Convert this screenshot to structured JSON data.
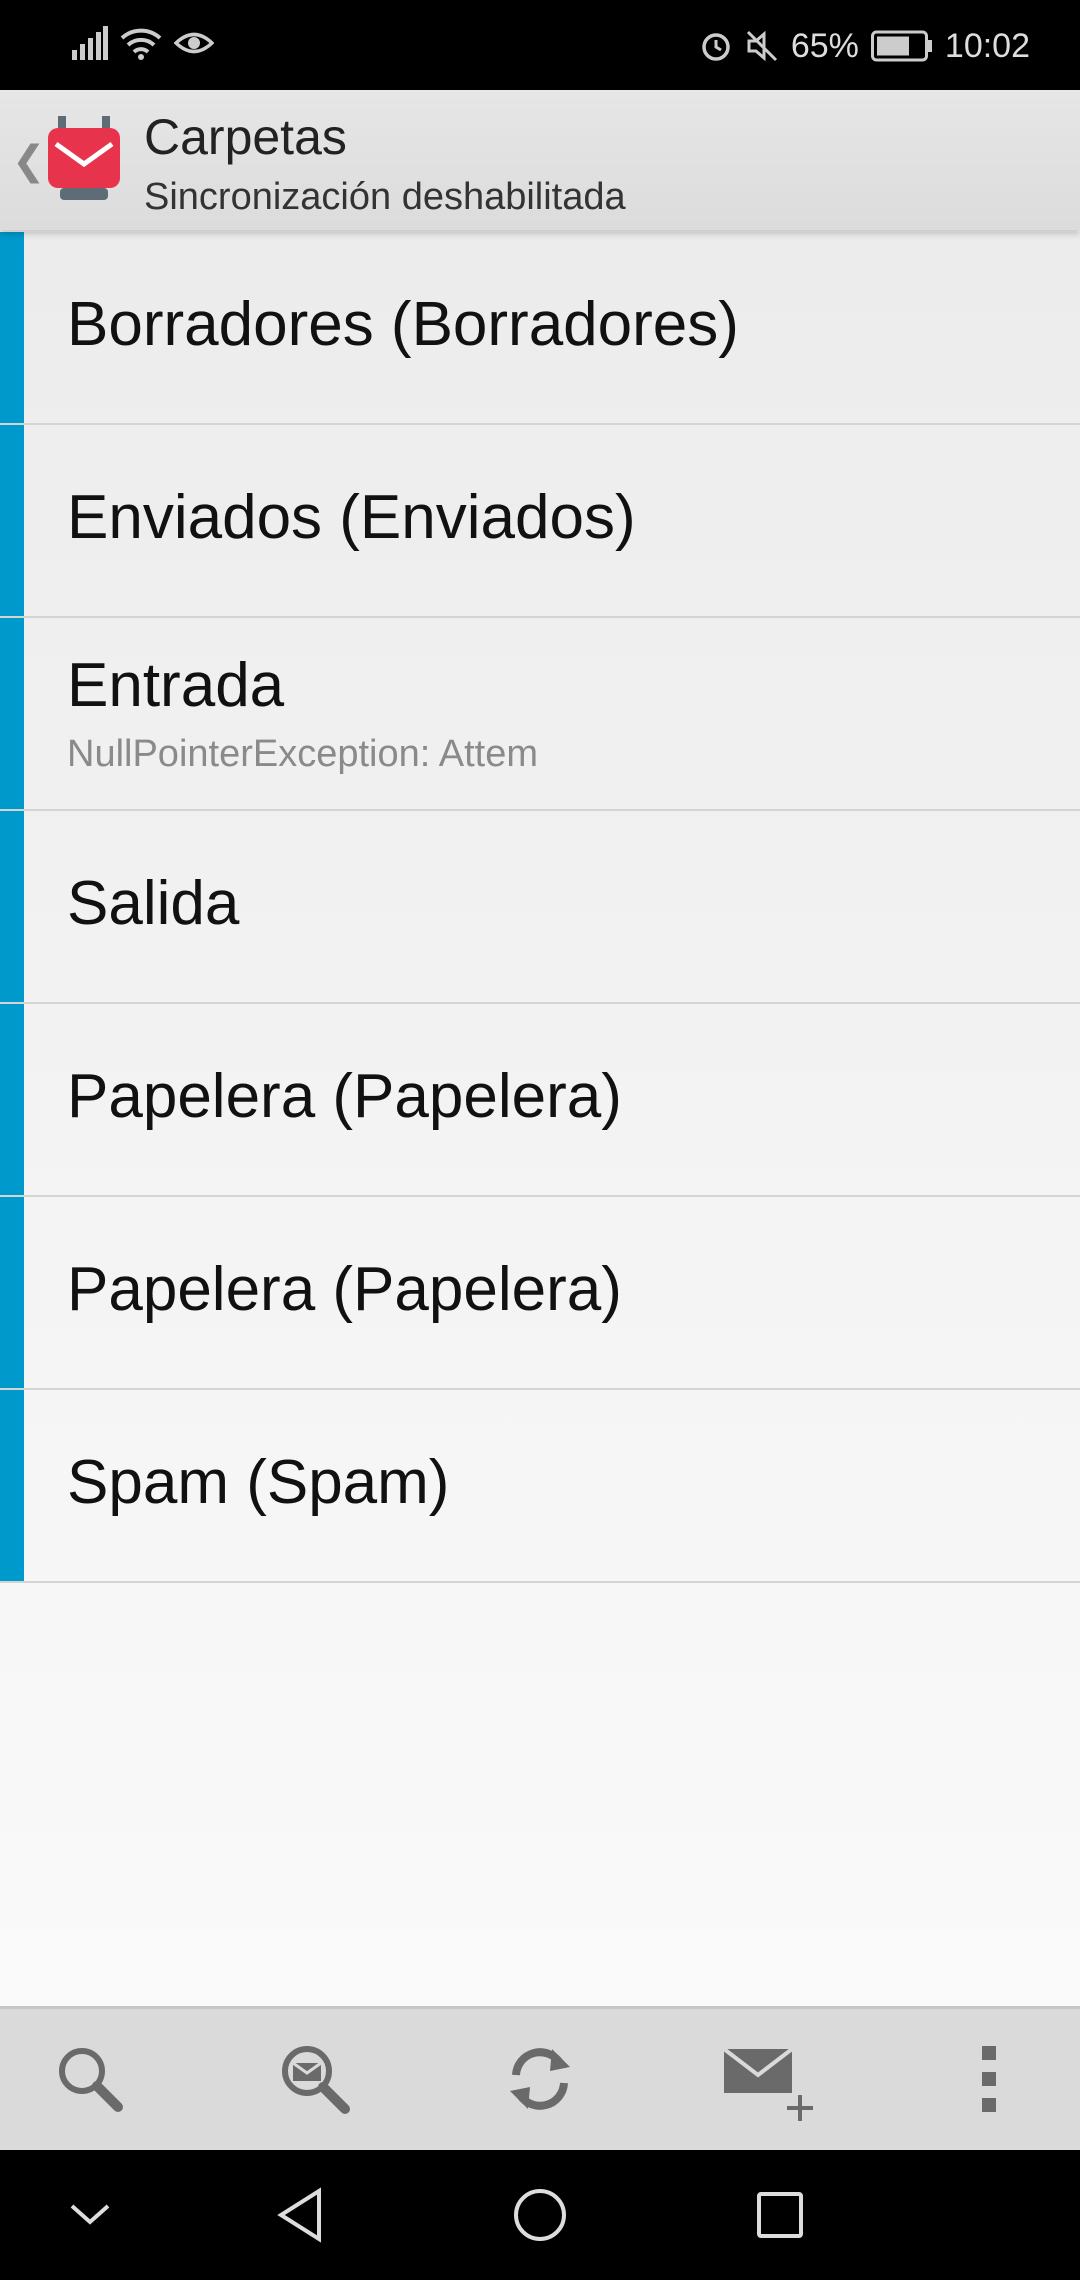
{
  "status_bar": {
    "battery_percent": "65%",
    "time": "10:02",
    "icons": [
      "signal-icon",
      "wifi-icon",
      "eye-icon",
      "alarm-icon",
      "mute-icon",
      "battery-icon"
    ]
  },
  "app_bar": {
    "title": "Carpetas",
    "subtitle": "Sincronización deshabilitada",
    "back_icon": "chevron-left-icon",
    "logo_icon": "mail-app-logo"
  },
  "colors": {
    "accent": "#0099cc",
    "logo_red": "#e8334d"
  },
  "folders": [
    {
      "name": "Borradores (Borradores)",
      "status": ""
    },
    {
      "name": "Enviados (Enviados)",
      "status": ""
    },
    {
      "name": "Entrada",
      "status": "NullPointerException: Attem"
    },
    {
      "name": "Salida",
      "status": ""
    },
    {
      "name": "Papelera (Papelera)",
      "status": ""
    },
    {
      "name": "Papelera (Papelera)",
      "status": ""
    },
    {
      "name": "Spam (Spam)",
      "status": ""
    }
  ],
  "toolbar": {
    "icons": [
      "search-icon",
      "search-messages-icon",
      "refresh-icon",
      "compose-icon",
      "overflow-menu-icon"
    ]
  },
  "nav_bar": {
    "icons": [
      "nav-collapse-icon",
      "back-icon",
      "home-icon",
      "recents-icon"
    ]
  }
}
